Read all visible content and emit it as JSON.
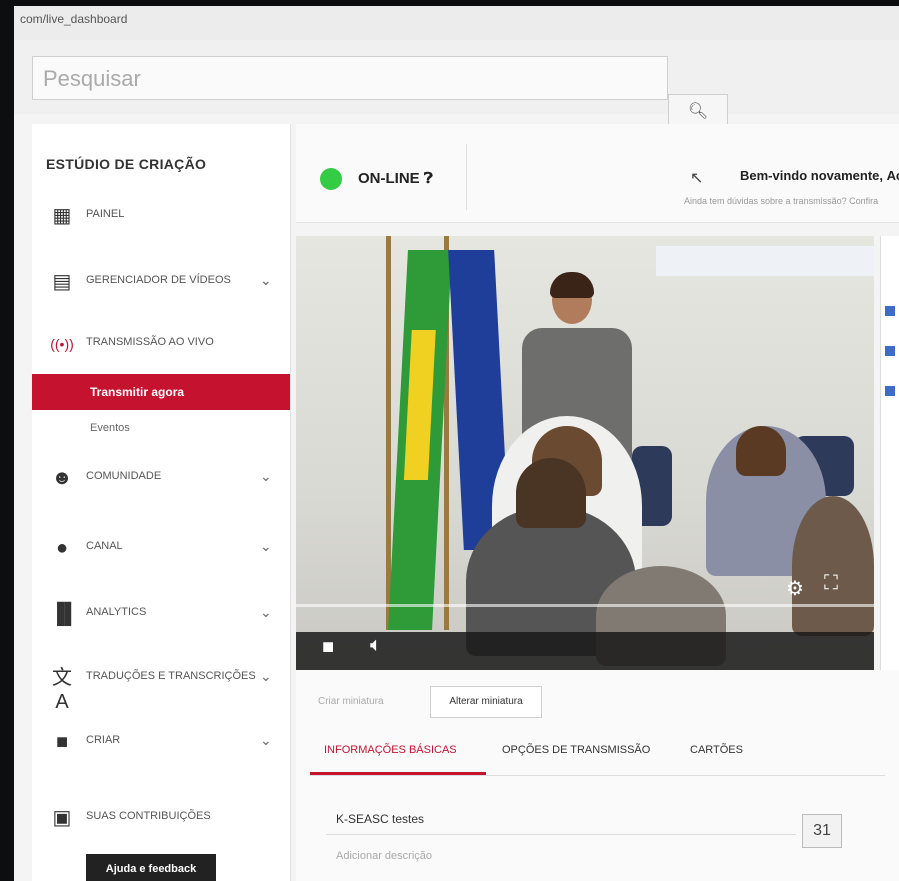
{
  "browser": {
    "url": "com/live_dashboard"
  },
  "search": {
    "placeholder": "Pesquisar",
    "button_icon": "search-icon"
  },
  "sidebar": {
    "title": "ESTÚDIO DE CRIAÇÃO",
    "items": [
      {
        "icon": "dashboard-icon",
        "label": "PAINEL"
      },
      {
        "icon": "video-manager-icon",
        "label": "GERENCIADOR DE VÍDEOS",
        "expandable": true
      },
      {
        "icon": "live-broadcast-icon",
        "label": "TRANSMISSÃO AO VIVO"
      },
      {
        "icon": "community-icon",
        "label": "COMUNIDADE",
        "expandable": true
      },
      {
        "icon": "channel-icon",
        "label": "CANAL",
        "expandable": true
      },
      {
        "icon": "analytics-icon",
        "label": "ANALYTICS",
        "expandable": true
      },
      {
        "icon": "translate-icon",
        "label": "TRADUÇÕES E TRANSCRIÇÕES",
        "expandable": true
      },
      {
        "icon": "create-icon",
        "label": "CRIAR",
        "expandable": true
      },
      {
        "icon": "contributions-icon",
        "label": "SUAS CONTRIBUIÇÕES"
      }
    ],
    "active_sub": "Transmitir agora",
    "sub_item": "Eventos",
    "feedback_label": "Ajuda e feedback"
  },
  "status": {
    "state": "ON-LINE",
    "indicator_color": "#33cc44",
    "welcome": "Bem-vindo novamente, Ассо",
    "welcome_sub": "Ainda tem dúvidas sobre a transmissão? Confira"
  },
  "video": {
    "controls": [
      "stop-icon",
      "volume-icon",
      "settings-icon",
      "fullscreen-icon"
    ]
  },
  "thumbnail": {
    "label": "Criar miniatura",
    "change_button": "Alterar miniatura"
  },
  "tabs": [
    {
      "label": "INFORMAÇÕES BÁSICAS",
      "active": true
    },
    {
      "label": "OPÇÕES DE TRANSMISSÃO",
      "active": false
    },
    {
      "label": "CARTÕES",
      "active": false
    }
  ],
  "form": {
    "title_value": "K-SEASC testes",
    "description_placeholder": "Adicionar descrição"
  },
  "page_number": "31",
  "accent_color": "#c4122f"
}
